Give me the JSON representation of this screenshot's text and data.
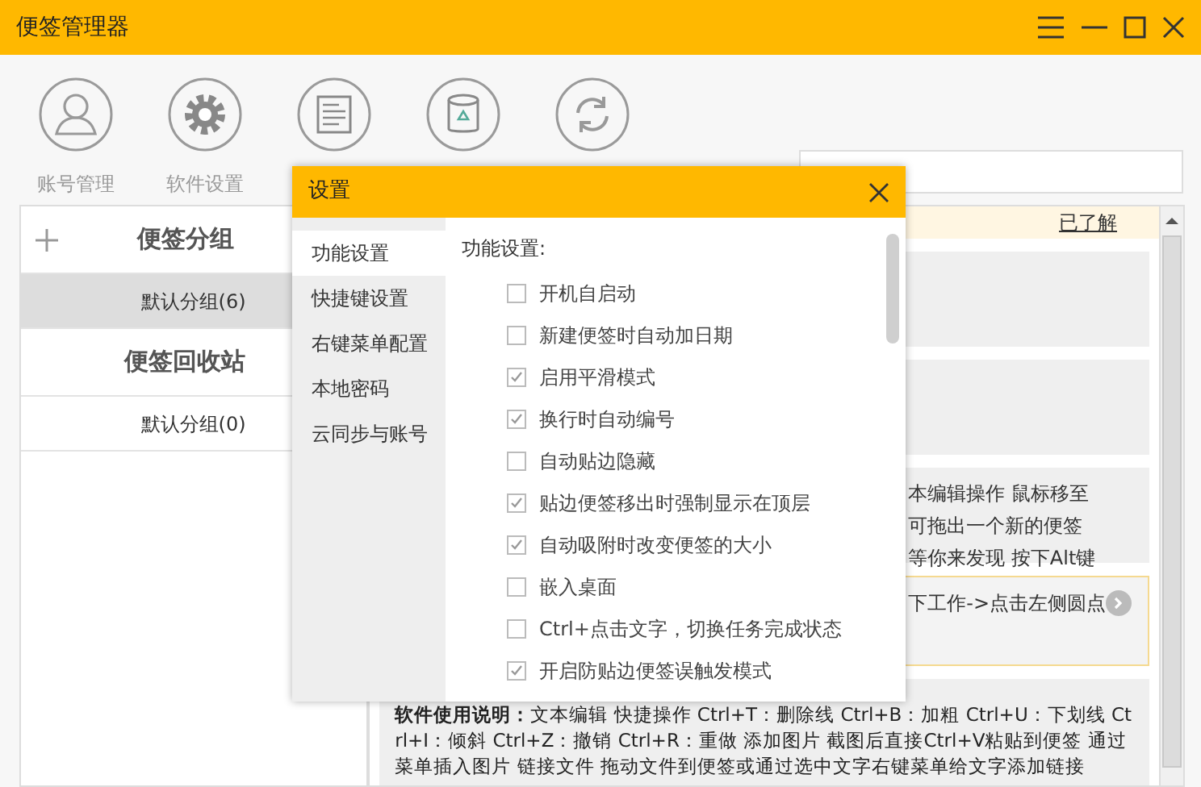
{
  "window": {
    "title": "便签管理器"
  },
  "toolbar": [
    {
      "kind": "user",
      "label": "账号管理"
    },
    {
      "kind": "gear",
      "label": "软件设置"
    },
    {
      "kind": "note"
    },
    {
      "kind": "bin"
    },
    {
      "kind": "sync"
    }
  ],
  "sidebar": {
    "groups_title": "便签分组",
    "groups": [
      {
        "label": "默认分组(6)",
        "selected": true
      }
    ],
    "recycle_title": "便签回收站",
    "recycle": [
      {
        "label": "默认分组(0)",
        "selected": false
      }
    ]
  },
  "notice": {
    "link": "已了解"
  },
  "notes": [
    {
      "kind": "blank"
    },
    {
      "kind": "blank"
    },
    {
      "kind": "text",
      "lines": [
        "本编辑操作  鼠标移至",
        "可拖出一个新的便签",
        "等你来发现  按下Alt键"
      ]
    },
    {
      "kind": "task",
      "lines": [
        "下工作->点击左侧圆点"
      ]
    }
  ],
  "help_note": "**软件使用说明：**文本编辑  快捷操作 Ctrl+T：删除线 Ctrl+B：加粗 Ctrl+U：下划线 Ctrl+I：倾斜 Ctrl+Z：撤销 Ctrl+R：重做  添加图片 截图后直接Ctrl+V粘贴到便签 通过菜单插入图片  链接文件 拖动文件到便签或通过选中文字右键菜单给文字添加链接",
  "dialog": {
    "title": "设置",
    "nav": [
      {
        "label": "功能设置",
        "selected": true
      },
      {
        "label": "快捷键设置",
        "selected": false
      },
      {
        "label": "右键菜单配置",
        "selected": false
      },
      {
        "label": "本地密码",
        "selected": false
      },
      {
        "label": "云同步与账号",
        "selected": false
      }
    ],
    "section": "功能设置:",
    "options": [
      {
        "label": "开机自启动",
        "checked": false
      },
      {
        "label": "新建便签时自动加日期",
        "checked": false
      },
      {
        "label": "启用平滑模式",
        "checked": true
      },
      {
        "label": "换行时自动编号",
        "checked": true
      },
      {
        "label": "自动贴边隐藏",
        "checked": false
      },
      {
        "label": "贴边便签移出时强制显示在顶层",
        "checked": true
      },
      {
        "label": "自动吸附时改变便签的大小",
        "checked": true
      },
      {
        "label": "嵌入桌面",
        "checked": false
      },
      {
        "label": "Ctrl+点击文字，切换任务完成状态",
        "checked": false
      },
      {
        "label": "开启防贴边便签误触发模式",
        "checked": true
      }
    ]
  }
}
